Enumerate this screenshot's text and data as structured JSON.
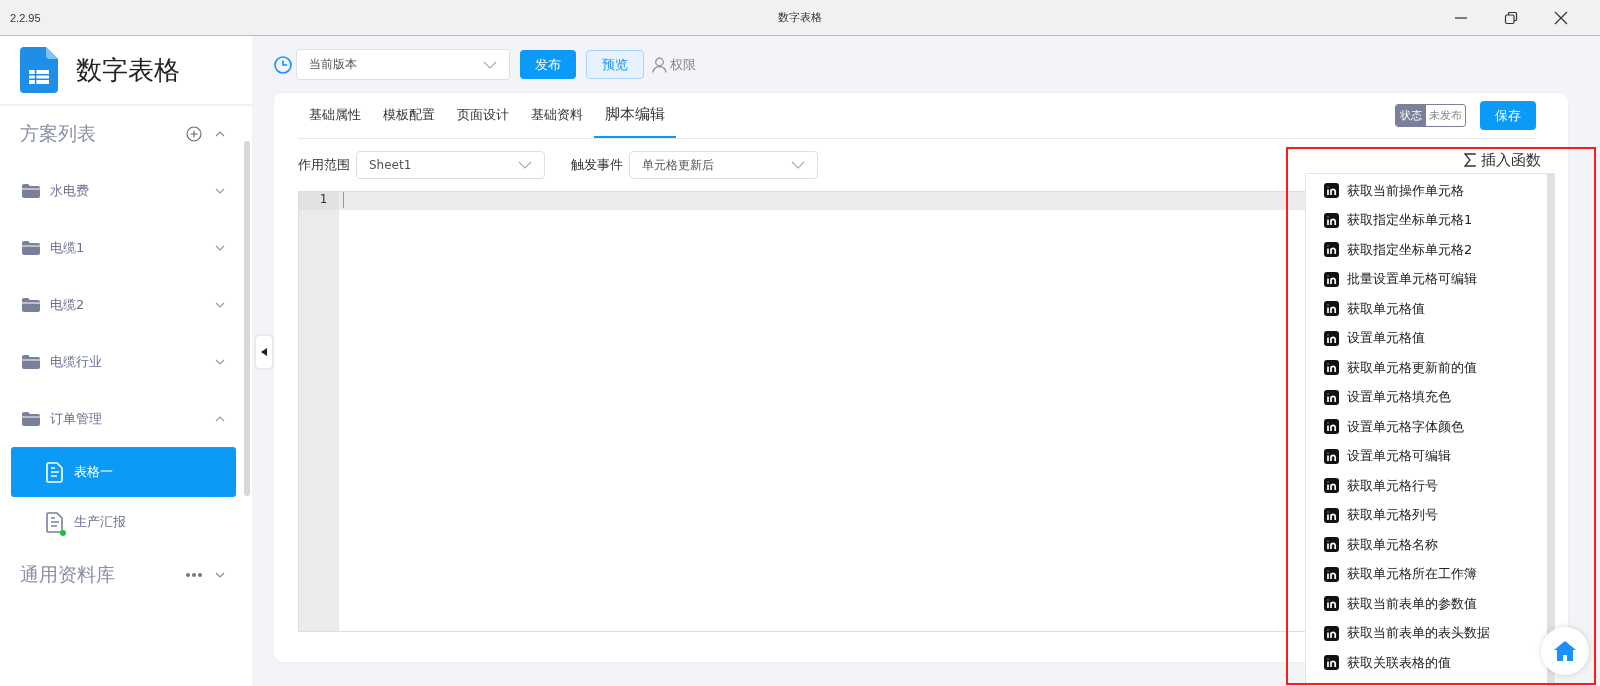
{
  "window": {
    "version": "2.2.95",
    "title": "数字表格"
  },
  "sidebar": {
    "app_name": "数字表格",
    "section_title": "方案列表",
    "folders": [
      {
        "label": "水电费",
        "expanded": false
      },
      {
        "label": "电缆1",
        "expanded": false
      },
      {
        "label": "电缆2",
        "expanded": false
      },
      {
        "label": "电缆行业",
        "expanded": false
      },
      {
        "label": "订单管理",
        "expanded": true,
        "children": [
          {
            "label": "表格一",
            "selected": true,
            "online": false
          },
          {
            "label": "生产汇报",
            "selected": false,
            "online": true
          }
        ]
      }
    ],
    "library_title": "通用资料库"
  },
  "toolbar": {
    "version_select": {
      "value": "当前版本"
    },
    "buttons": [
      {
        "label": "发布",
        "kind": "primary"
      },
      {
        "label": "预览",
        "kind": "secondary"
      },
      {
        "label": "权限",
        "kind": "link"
      }
    ]
  },
  "tabs": [
    {
      "label": "基础属性",
      "selected": false
    },
    {
      "label": "模板配置",
      "selected": false
    },
    {
      "label": "页面设计",
      "selected": false
    },
    {
      "label": "基础资料",
      "selected": false
    },
    {
      "label": "脚本编辑",
      "selected": true
    }
  ],
  "status": {
    "label": "状态",
    "value": "未发布"
  },
  "save_button": "保存",
  "filters": [
    {
      "label": "作用范围",
      "value": "Sheet1"
    },
    {
      "label": "触发事件",
      "value": "单元格更新后"
    }
  ],
  "editor": {
    "line_numbers": [
      "1"
    ]
  },
  "function_panel": {
    "title": "插入函数",
    "items": [
      "获取当前操作单元格",
      "获取指定坐标单元格1",
      "获取指定坐标单元格2",
      "批量设置单元格可编辑",
      "获取单元格值",
      "设置单元格值",
      "获取单元格更新前的值",
      "设置单元格填充色",
      "设置单元格字体颜色",
      "设置单元格可编辑",
      "获取单元格行号",
      "获取单元格列号",
      "获取单元格名称",
      "获取单元格所在工作簿",
      "获取当前表单的参数值",
      "获取当前表单的表头数据",
      "获取关联表格的值"
    ]
  }
}
